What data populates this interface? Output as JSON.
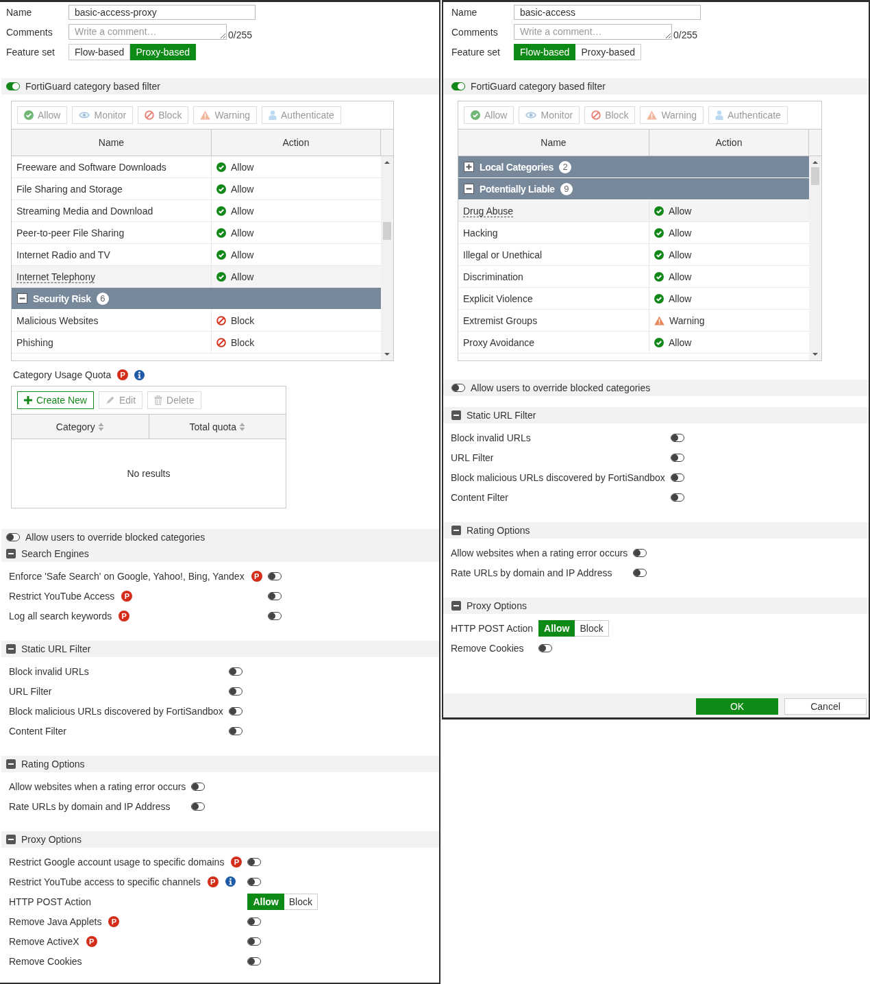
{
  "panels": [
    {
      "form": {
        "name": {
          "label": "Name",
          "value": "basic-access-proxy"
        },
        "comments": {
          "label": "Comments",
          "placeholder": "Write a comment…",
          "counter": "0/255"
        },
        "feature_set": {
          "label": "Feature set",
          "options": [
            {
              "label": "Flow-based",
              "selected": false
            },
            {
              "label": "Proxy-based",
              "selected": true
            }
          ]
        }
      },
      "category_filter": {
        "label": "FortiGuard category based filter",
        "on": true,
        "tools": [
          {
            "kind": "allow",
            "label": "Allow",
            "disabled": true
          },
          {
            "kind": "monitor",
            "label": "Monitor",
            "disabled": true
          },
          {
            "kind": "block",
            "label": "Block",
            "disabled": true
          },
          {
            "kind": "warning",
            "label": "Warning",
            "disabled": true
          },
          {
            "kind": "authenticate",
            "label": "Authenticate",
            "disabled": true
          }
        ],
        "columns": [
          "Name",
          "Action"
        ],
        "rows": [
          {
            "kind": "item",
            "name": "Freeware and Software Downloads",
            "action": {
              "kind": "allow",
              "label": "Allow"
            },
            "hovered": false
          },
          {
            "kind": "item",
            "name": "File Sharing and Storage",
            "action": {
              "kind": "allow",
              "label": "Allow"
            },
            "hovered": false
          },
          {
            "kind": "item",
            "name": "Streaming Media and Download",
            "action": {
              "kind": "allow",
              "label": "Allow"
            },
            "hovered": false
          },
          {
            "kind": "item",
            "name": "Peer-to-peer File Sharing",
            "action": {
              "kind": "allow",
              "label": "Allow"
            },
            "hovered": false
          },
          {
            "kind": "item",
            "name": "Internet Radio and TV",
            "action": {
              "kind": "allow",
              "label": "Allow"
            },
            "hovered": false
          },
          {
            "kind": "item",
            "name": "Internet Telephony",
            "action": {
              "kind": "allow",
              "label": "Allow"
            },
            "hovered": true
          },
          {
            "kind": "group",
            "name": "Security Risk",
            "count": "6",
            "expanded": true
          },
          {
            "kind": "item",
            "name": "Malicious Websites",
            "action": {
              "kind": "block",
              "label": "Block"
            },
            "hovered": false
          },
          {
            "kind": "item",
            "name": "Phishing",
            "action": {
              "kind": "block",
              "label": "Block"
            },
            "hovered": false
          }
        ]
      },
      "quota": {
        "label": "Category Usage Quota",
        "badges": [
          {
            "kind": "proxy",
            "text": "P"
          },
          {
            "kind": "info"
          }
        ],
        "tools": [
          {
            "kind": "create",
            "label": "Create New",
            "disabled": false
          },
          {
            "kind": "edit",
            "label": "Edit",
            "disabled": true
          },
          {
            "kind": "delete",
            "label": "Delete",
            "disabled": true
          }
        ],
        "columns": [
          "Category",
          "Total quota"
        ],
        "empty": "No results"
      },
      "override": {
        "label": "Allow users to override blocked categories",
        "on": false
      },
      "sections": [
        {
          "title": "Search Engines",
          "expanded": true,
          "rows": [
            {
              "kind": "toggle",
              "label": "Enforce 'Safe Search' on Google, Yahoo!, Bing, Yandex",
              "badges": [
                {
                  "kind": "proxy",
                  "text": "P"
                }
              ],
              "on": false
            },
            {
              "kind": "toggle",
              "label": "Restrict YouTube Access",
              "badges": [
                {
                  "kind": "proxy",
                  "text": "P"
                }
              ],
              "on": false
            },
            {
              "kind": "toggle",
              "label": "Log all search keywords",
              "badges": [
                {
                  "kind": "proxy",
                  "text": "P"
                }
              ],
              "on": false
            }
          ]
        },
        {
          "title": "Static URL Filter",
          "expanded": true,
          "rows": [
            {
              "kind": "toggle",
              "label": "Block invalid URLs",
              "on": false
            },
            {
              "kind": "toggle",
              "label": "URL Filter",
              "on": false
            },
            {
              "kind": "toggle",
              "label": "Block malicious URLs discovered by FortiSandbox",
              "on": false
            },
            {
              "kind": "toggle",
              "label": "Content Filter",
              "on": false
            }
          ]
        },
        {
          "title": "Rating Options",
          "expanded": true,
          "rows": [
            {
              "kind": "toggle",
              "label": "Allow websites when a rating error occurs",
              "on": false
            },
            {
              "kind": "toggle",
              "label": "Rate URLs by domain and IP Address",
              "on": false
            }
          ]
        },
        {
          "title": "Proxy Options",
          "expanded": true,
          "rows": [
            {
              "kind": "toggle",
              "label": "Restrict Google account usage to specific domains",
              "badges": [
                {
                  "kind": "proxy",
                  "text": "P"
                }
              ],
              "on": false
            },
            {
              "kind": "toggle",
              "label": "Restrict YouTube access to specific channels",
              "badges": [
                {
                  "kind": "proxy",
                  "text": "P"
                },
                {
                  "kind": "info"
                }
              ],
              "on": false
            },
            {
              "kind": "choice",
              "label": "HTTP POST Action",
              "options": [
                {
                  "label": "Allow",
                  "selected": true
                },
                {
                  "label": "Block",
                  "selected": false
                }
              ]
            },
            {
              "kind": "toggle",
              "label": "Remove Java Applets",
              "badges": [
                {
                  "kind": "proxy",
                  "text": "P"
                }
              ],
              "on": false
            },
            {
              "kind": "toggle",
              "label": "Remove ActiveX",
              "badges": [
                {
                  "kind": "proxy",
                  "text": "P"
                }
              ],
              "on": false
            },
            {
              "kind": "toggle",
              "label": "Remove Cookies",
              "on": false
            }
          ]
        }
      ]
    },
    {
      "form": {
        "name": {
          "label": "Name",
          "value": "basic-access"
        },
        "comments": {
          "label": "Comments",
          "placeholder": "Write a comment…",
          "counter": "0/255"
        },
        "feature_set": {
          "label": "Feature set",
          "options": [
            {
              "label": "Flow-based",
              "selected": true
            },
            {
              "label": "Proxy-based",
              "selected": false
            }
          ]
        }
      },
      "category_filter": {
        "label": "FortiGuard category based filter",
        "on": true,
        "tools": [
          {
            "kind": "allow",
            "label": "Allow",
            "disabled": true
          },
          {
            "kind": "monitor",
            "label": "Monitor",
            "disabled": true
          },
          {
            "kind": "block",
            "label": "Block",
            "disabled": true
          },
          {
            "kind": "warning",
            "label": "Warning",
            "disabled": true
          },
          {
            "kind": "authenticate",
            "label": "Authenticate",
            "disabled": true
          }
        ],
        "columns": [
          "Name",
          "Action"
        ],
        "rows": [
          {
            "kind": "group",
            "name": "Local Categories",
            "count": "2",
            "expanded": false
          },
          {
            "kind": "group",
            "name": "Potentially Liable",
            "count": "9",
            "expanded": true
          },
          {
            "kind": "item",
            "name": "Drug Abuse",
            "action": {
              "kind": "allow",
              "label": "Allow"
            },
            "hovered": true
          },
          {
            "kind": "item",
            "name": "Hacking",
            "action": {
              "kind": "allow",
              "label": "Allow"
            },
            "hovered": false
          },
          {
            "kind": "item",
            "name": "Illegal or Unethical",
            "action": {
              "kind": "allow",
              "label": "Allow"
            },
            "hovered": false
          },
          {
            "kind": "item",
            "name": "Discrimination",
            "action": {
              "kind": "allow",
              "label": "Allow"
            },
            "hovered": false
          },
          {
            "kind": "item",
            "name": "Explicit Violence",
            "action": {
              "kind": "allow",
              "label": "Allow"
            },
            "hovered": false
          },
          {
            "kind": "item",
            "name": "Extremist Groups",
            "action": {
              "kind": "warning",
              "label": "Warning"
            },
            "hovered": false
          },
          {
            "kind": "item",
            "name": "Proxy Avoidance",
            "action": {
              "kind": "allow",
              "label": "Allow"
            },
            "hovered": false
          }
        ]
      },
      "override": {
        "label": "Allow users to override blocked categories",
        "on": false
      },
      "sections": [
        {
          "title": "Static URL Filter",
          "expanded": true,
          "rows": [
            {
              "kind": "toggle",
              "label": "Block invalid URLs",
              "on": false
            },
            {
              "kind": "toggle",
              "label": "URL Filter",
              "on": false
            },
            {
              "kind": "toggle",
              "label": "Block malicious URLs discovered by FortiSandbox",
              "on": false
            },
            {
              "kind": "toggle",
              "label": "Content Filter",
              "on": false
            }
          ]
        },
        {
          "title": "Rating Options",
          "expanded": true,
          "rows": [
            {
              "kind": "toggle",
              "label": "Allow websites when a rating error occurs",
              "on": false
            },
            {
              "kind": "toggle",
              "label": "Rate URLs by domain and IP Address",
              "on": false
            }
          ]
        },
        {
          "title": "Proxy Options",
          "expanded": true,
          "rows": [
            {
              "kind": "choice",
              "label": "HTTP POST Action",
              "options": [
                {
                  "label": "Allow",
                  "selected": true
                },
                {
                  "label": "Block",
                  "selected": false
                }
              ]
            },
            {
              "kind": "toggle",
              "label": "Remove Cookies",
              "on": false
            }
          ]
        }
      ],
      "footer": [
        {
          "kind": "primary",
          "label": "OK"
        },
        {
          "kind": "secondary",
          "label": "Cancel"
        }
      ]
    }
  ]
}
